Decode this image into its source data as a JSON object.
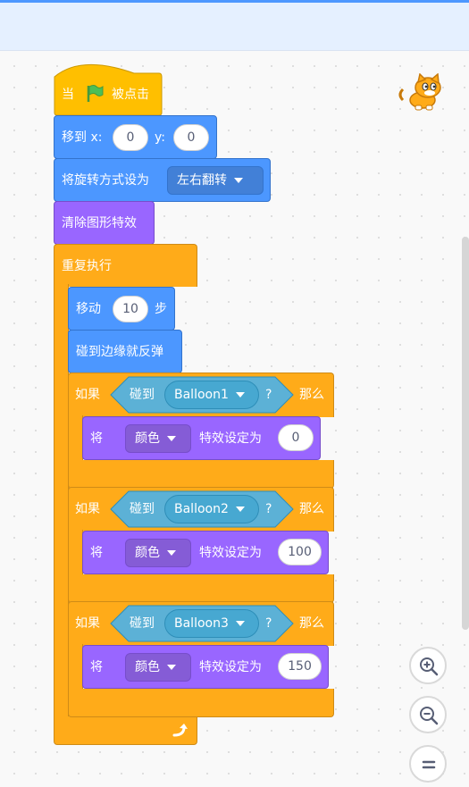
{
  "blocks": {
    "when_flag": {
      "prefix": "当",
      "suffix": "被点击"
    },
    "goto": {
      "label": "移到 x:",
      "x_value": "0",
      "y_label": "y:",
      "y_value": "0"
    },
    "rotation": {
      "label": "将旋转方式设为",
      "value": "左右翻转"
    },
    "clear_effects": {
      "label": "清除图形特效"
    },
    "forever": {
      "label": "重复执行"
    },
    "move": {
      "label": "移动",
      "steps": "10",
      "unit": "步"
    },
    "bounce": {
      "label": "碰到边缘就反弹"
    },
    "if_blocks": [
      {
        "if_label": "如果",
        "touching_label": "碰到",
        "target": "Balloon1",
        "question": "?",
        "then_label": "那么",
        "set_label": "将",
        "effect": "颜色",
        "effect_label": "特效设定为",
        "value": "0"
      },
      {
        "if_label": "如果",
        "touching_label": "碰到",
        "target": "Balloon2",
        "question": "?",
        "then_label": "那么",
        "set_label": "将",
        "effect": "颜色",
        "effect_label": "特效设定为",
        "value": "100"
      },
      {
        "if_label": "如果",
        "touching_label": "碰到",
        "target": "Balloon3",
        "question": "?",
        "then_label": "那么",
        "set_label": "将",
        "effect": "颜色",
        "effect_label": "特效设定为",
        "value": "150"
      }
    ]
  },
  "controls": {
    "zoom_in": "zoom-in-icon",
    "zoom_out": "zoom-out-icon",
    "reset": "reset-zoom-icon"
  },
  "colors": {
    "motion": "#4c97ff",
    "looks": "#9966ff",
    "control": "#ffab19",
    "events": "#ffbf00",
    "sensing": "#5cb1d6"
  }
}
